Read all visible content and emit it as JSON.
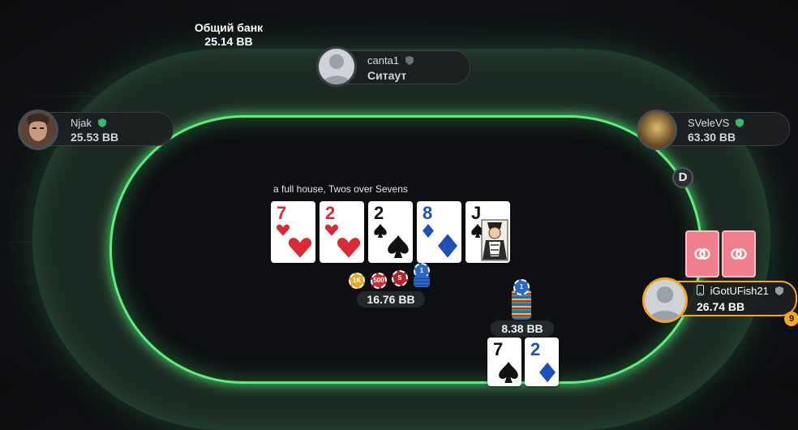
{
  "pot": {
    "label": "Общий банк",
    "amount": "25.14 BB"
  },
  "players": [
    {
      "id": "canta1",
      "name": "canta1",
      "stack": "Ситаут"
    },
    {
      "id": "njak",
      "name": "Njak",
      "stack": "25.53 BB"
    },
    {
      "id": "svelevs",
      "name": "SVeleVS",
      "stack": "63.30 BB"
    },
    {
      "id": "hero",
      "name": "iGotUFish21",
      "stack": "26.74 BB",
      "timer_badge": "9"
    }
  ],
  "dealer_button": "D",
  "hand_description": "a full house, Twos over Sevens",
  "board": [
    {
      "rank": "7",
      "suit": "hearts",
      "color": "#d92b35"
    },
    {
      "rank": "2",
      "suit": "hearts",
      "color": "#d92b35"
    },
    {
      "rank": "2",
      "suit": "spades",
      "color": "#111111"
    },
    {
      "rank": "8",
      "suit": "diamonds",
      "color": "#1d4fb8"
    },
    {
      "rank": "J",
      "suit": "spades",
      "color": "#111111"
    }
  ],
  "center_bet": {
    "amount": "16.76 BB",
    "chips": [
      "1K",
      "500",
      "5",
      "1"
    ]
  },
  "hero_bet": {
    "amount": "8.38 BB",
    "chips": [
      "1"
    ]
  },
  "hero_cards": [
    {
      "rank": "7",
      "suit": "spades",
      "color": "#111111"
    },
    {
      "rank": "2",
      "suit": "diamonds",
      "color": "#1d4fb8"
    }
  ],
  "colors": {
    "felt_glow": "#5bf07b",
    "hero_ring": "#f5a623",
    "card_back": "#f07f8b"
  }
}
